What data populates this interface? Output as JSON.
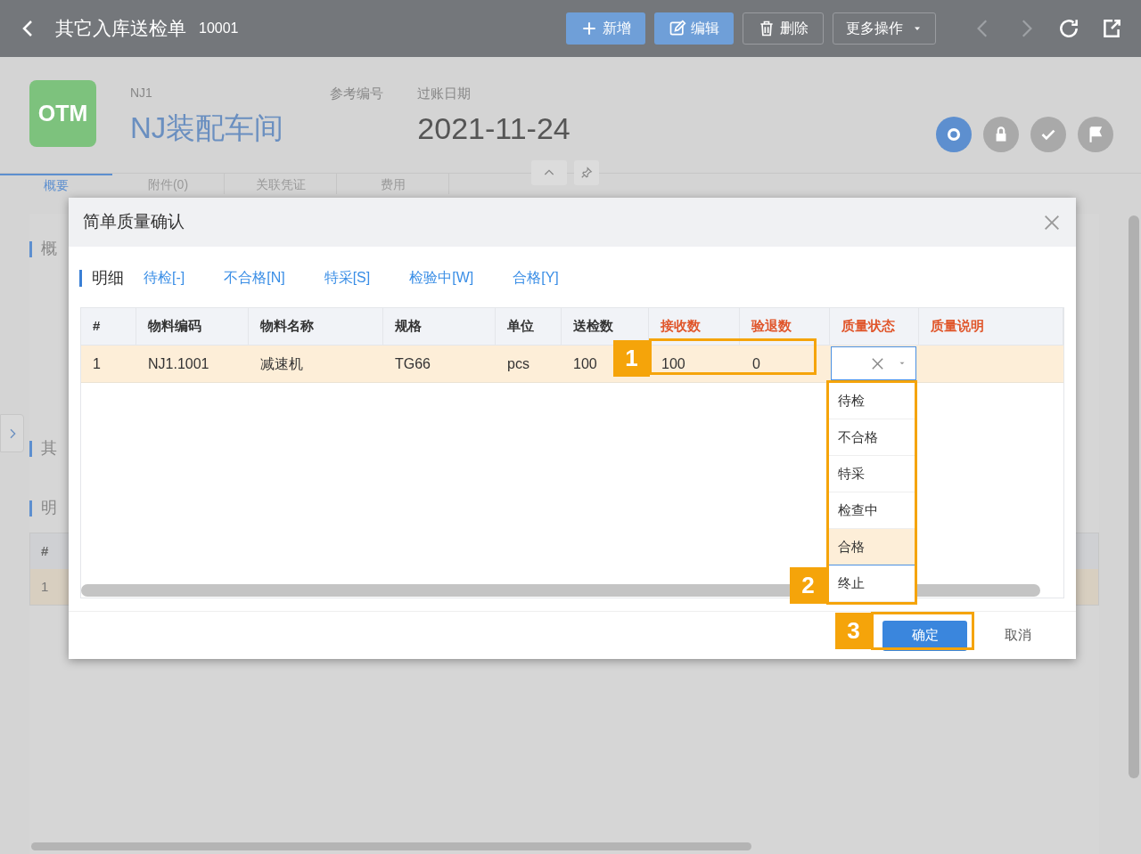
{
  "header": {
    "title": "其它入库送检单",
    "doc_no": "10001",
    "buttons": [
      {
        "kind": "plus",
        "label": "新增"
      },
      {
        "kind": "edit",
        "label": "编辑"
      },
      {
        "kind": "trash",
        "label": "删除"
      }
    ],
    "more": "更多操作"
  },
  "record": {
    "logo": "OTM",
    "code": "NJ1",
    "name": "NJ装配车间",
    "ref_label": "参考编号",
    "date_label": "过账日期",
    "date": "2021-11-24"
  },
  "status_steps": [
    {
      "kind": "circle",
      "selected": true
    },
    {
      "kind": "lock",
      "selected": false
    },
    {
      "kind": "check",
      "selected": false
    },
    {
      "kind": "flag",
      "selected": false
    }
  ],
  "tabs": [
    {
      "label": "概要",
      "selected": true
    },
    {
      "label": "附件(0)",
      "selected": false
    },
    {
      "label": "关联凭证",
      "selected": false
    },
    {
      "label": "费用",
      "selected": false
    }
  ],
  "sections": [
    "概",
    "其",
    "明"
  ],
  "background_table": {
    "columns": [
      "#"
    ],
    "rows": [
      [
        "1"
      ]
    ]
  },
  "dialog": {
    "title": "简单质量确认",
    "detail_label": "明细",
    "filters": [
      "待检[-]",
      "不合格[N]",
      "特采[S]",
      "检验中[W]",
      "合格[Y]"
    ],
    "columns": [
      {
        "label": "#",
        "editable": false
      },
      {
        "label": "物料编码",
        "editable": false
      },
      {
        "label": "物料名称",
        "editable": false
      },
      {
        "label": "规格",
        "editable": false
      },
      {
        "label": "单位",
        "editable": false
      },
      {
        "label": "送检数",
        "editable": false
      },
      {
        "label": "接收数",
        "editable": true
      },
      {
        "label": "验退数",
        "editable": true
      },
      {
        "label": "质量状态",
        "editable": true
      },
      {
        "label": "质量说明",
        "editable": true
      }
    ],
    "rows": [
      {
        "selected": true,
        "cells": [
          "1",
          "NJ1.1001",
          "减速机",
          "TG66",
          "pcs",
          "100",
          "100",
          "0"
        ]
      }
    ],
    "options": [
      {
        "label": "待检",
        "selected": false
      },
      {
        "label": "不合格",
        "selected": false
      },
      {
        "label": "特采",
        "selected": false
      },
      {
        "label": "检查中",
        "selected": false
      },
      {
        "label": "合格",
        "selected": true
      },
      {
        "label": "终止",
        "selected": false
      }
    ],
    "confirm": "确定",
    "cancel": "取消"
  },
  "callouts": [
    {
      "label": "1"
    },
    {
      "label": "2"
    },
    {
      "label": "3"
    }
  ]
}
